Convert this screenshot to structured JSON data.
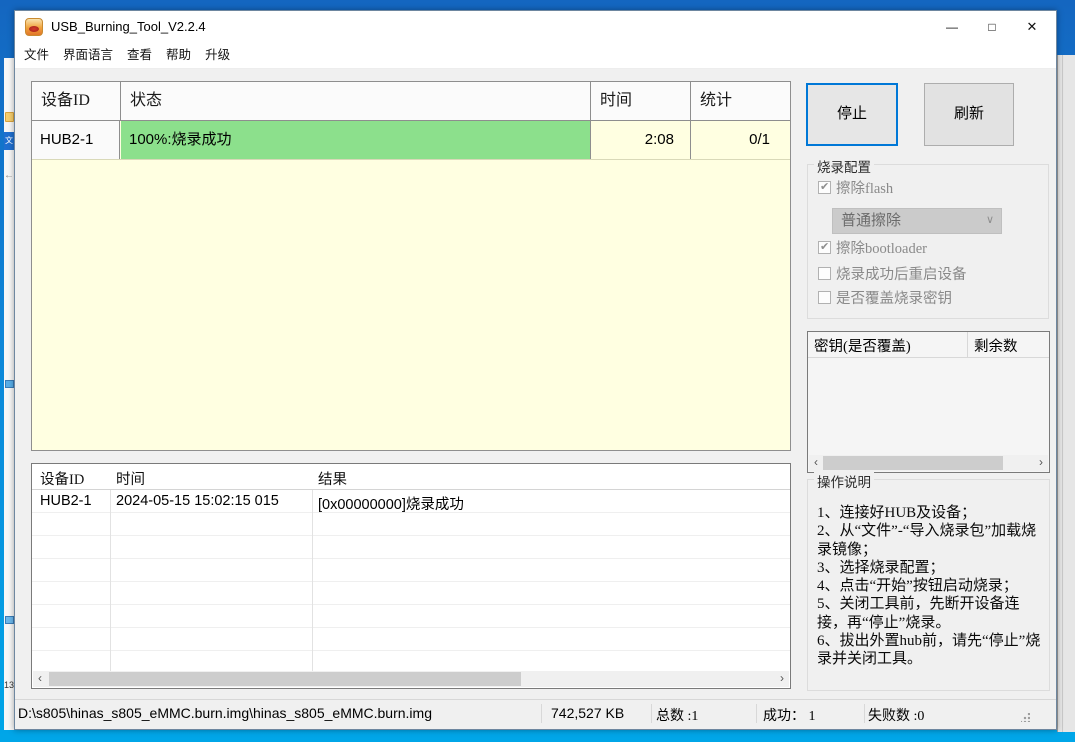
{
  "window": {
    "title": "USB_Burning_Tool_V2.2.4",
    "controls": {
      "minimize": "—",
      "maximize": "□",
      "close": "✕"
    }
  },
  "menu": {
    "items": [
      {
        "label": "文件"
      },
      {
        "label": "界面语言"
      },
      {
        "label": "查看"
      },
      {
        "label": "帮助"
      },
      {
        "label": "升级"
      }
    ]
  },
  "device_table": {
    "headers": {
      "device_id": "设备ID",
      "status": "状态",
      "time": "时间",
      "stat": "统计"
    },
    "row": {
      "device_id": "HUB2-1",
      "status": "100%:烧录成功",
      "time": "2:08",
      "stat": "0/1"
    },
    "status_color": "#8CE08C",
    "body_color": "#FFFFE1"
  },
  "actions": {
    "stop": "停止",
    "refresh": "刷新"
  },
  "burn_config": {
    "title": "烧录配置",
    "erase_flash": {
      "label": "擦除flash",
      "checked": true,
      "check_glyph": "✔"
    },
    "erase_mode_select": {
      "value": "普通擦除",
      "chevron_glyph": "∨"
    },
    "erase_bootloader": {
      "label": "擦除bootloader",
      "checked": true,
      "check_glyph": "✔"
    },
    "reboot_after_success": {
      "label": "烧录成功后重启设备",
      "checked": false,
      "check_glyph": ""
    },
    "overwrite_burn_key": {
      "label": "是否覆盖烧录密钥",
      "checked": false,
      "check_glyph": ""
    }
  },
  "key_table": {
    "headers": {
      "key": "密钥(是否覆盖)",
      "remaining": "剩余数"
    },
    "rows": []
  },
  "instructions": {
    "title": "操作说明",
    "steps": [
      "1、连接好HUB及设备；",
      "2、从“文件”-“导入烧录包”加载烧录镜像；",
      "3、选择烧录配置；",
      "4、点击“开始”按钮启动烧录；",
      "5、关闭工具前，先断开设备连接，再“停止”烧录。",
      "6、拔出外置hub前，请先“停止”烧录并关闭工具。"
    ]
  },
  "log_table": {
    "headers": {
      "device_id": "设备ID",
      "time": "时间",
      "result": "结果"
    },
    "row": {
      "device_id": "HUB2-1",
      "time": "2024-05-15 15:02:15 015",
      "result": "[0x00000000]烧录成功"
    }
  },
  "status_bar": {
    "file_path": "D:\\s805\\hinas_s805_eMMC.burn.img\\hinas_s805_eMMC.burn.img",
    "file_size": "742,527 KB",
    "total": "总数 :1",
    "success": "成功： 1",
    "failed": "失败数 :0"
  },
  "icons": {
    "scroll_left": "‹",
    "scroll_right": "›"
  },
  "background": {
    "left_strip": {
      "lang_glyph": "文",
      "arrow_glyph": "←",
      "label": "13"
    }
  },
  "colors": {
    "accent_focus": "#0078D7",
    "success_green": "#8CE08C",
    "info_yellow": "#FFFFE1",
    "desktop_blue": "#0E86D8"
  }
}
